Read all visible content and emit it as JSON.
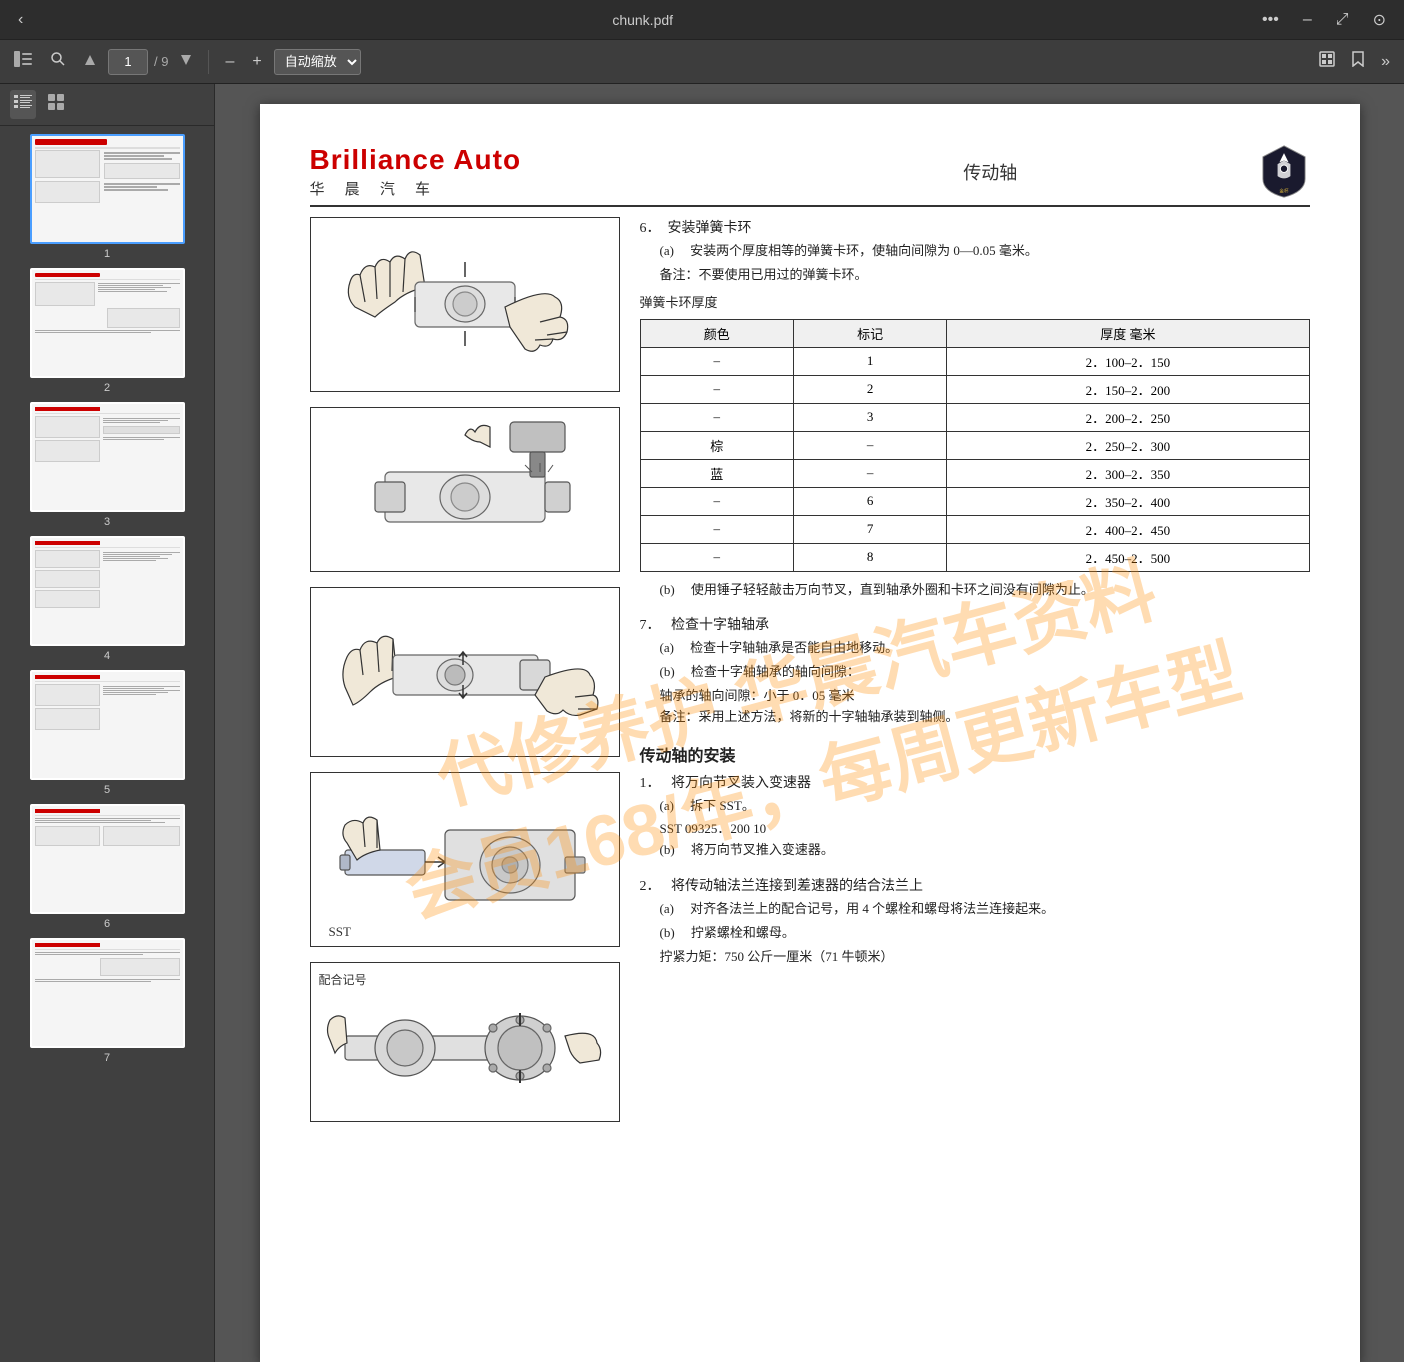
{
  "window": {
    "title": "chunk.pdf",
    "back_label": "‹",
    "more_label": "•••",
    "minimize_label": "–",
    "restore_label": "⤢",
    "close_label": "⊙"
  },
  "toolbar": {
    "sidebar_toggle": "☰",
    "search_label": "🔍",
    "prev_page": "▲",
    "next_page": "▼",
    "current_page": "1",
    "total_pages": "9",
    "zoom_out": "–",
    "zoom_in": "+",
    "zoom_value": "自动缩放",
    "fullscreen": "⛶",
    "bookmark": "🔖",
    "menu": "»"
  },
  "sidebar": {
    "list_view_label": "☰",
    "grid_view_label": "⊞",
    "thumbnails": [
      {
        "num": "1",
        "active": true
      },
      {
        "num": "2",
        "active": false
      },
      {
        "num": "3",
        "active": false
      },
      {
        "num": "4",
        "active": false
      },
      {
        "num": "5",
        "active": false
      },
      {
        "num": "6",
        "active": false
      },
      {
        "num": "7",
        "active": false
      }
    ]
  },
  "page": {
    "brand_en": "Brilliance Auto",
    "brand_cn": "华 晨 汽 车",
    "page_title": "传动轴",
    "section6_title": "6．　安装弹簧卡环",
    "s6a": "(a)　 安装两个厚度相等的弹簧卡环，使轴向间隙为 0—0.05 毫米。",
    "s6_note1": "备注：不要使用已用过的弹簧卡环。",
    "s6_table_title": "弹簧卡环厚度",
    "table_headers": [
      "颜色",
      "标记",
      "厚度 毫米"
    ],
    "table_rows": [
      [
        "–",
        "1",
        "2．100–2．150"
      ],
      [
        "–",
        "2",
        "2．150–2．200"
      ],
      [
        "–",
        "3",
        "2．200–2．250"
      ],
      [
        "棕",
        "–",
        "2．250–2．300"
      ],
      [
        "蓝",
        "–",
        "2．300–2．350"
      ],
      [
        "–",
        "6",
        "2．350–2．400"
      ],
      [
        "–",
        "7",
        "2．400–2．450"
      ],
      [
        "–",
        "8",
        "2．450–2．500"
      ]
    ],
    "s6b": "(b)　 使用锤子轻轻敲击万向节叉，直到轴承外圈和卡环之间没有间隙为止。",
    "section7_title": "7．　 检查十字轴轴承",
    "s7a": "(a)　 检查十字轴轴承是否能自由地移动。",
    "s7b": "(b)　 检查十字轴轴承的轴向间隙：",
    "s7_note1": "轴承的轴向间隙：小于 0．05 毫米",
    "s7_note2": "备注：采用上述方法，将新的十字轴轴承装到轴侧。",
    "section_install_title": "传动轴的安装",
    "section1_title": "1．　 将万向节叉装入变速器",
    "s1a": "(a)　 拆下 SST。",
    "s1_sst": "SST 09325．200 10",
    "s1b": "(b)　 将万向节叉推入变速器。",
    "section2_title": "2．　 将传动轴法兰连接到差速器的结合法兰上",
    "s2a": "(a)　 对齐各法兰上的配合记号，用 4 个螺栓和螺母将法兰连接起来。",
    "s2b": "(b)　 拧紧螺栓和螺母。",
    "s2_torque": "拧紧力矩：750 公斤一厘米（71 牛顿米）",
    "watermark_line1": "代修养护 华晨汽车资料",
    "watermark_line2": "会员168/年，每周更新车型",
    "sst_label": "SST",
    "fig5_note": "配合记号"
  }
}
